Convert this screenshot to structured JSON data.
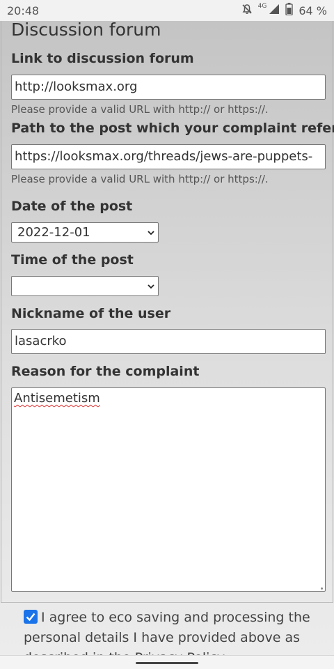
{
  "status_bar": {
    "time": "20:48",
    "network": "4G",
    "battery": "64 %"
  },
  "form": {
    "section_title": "Discussion forum",
    "forum_link": {
      "label": "Link to discussion forum",
      "value": "http://looksmax.org",
      "hint": "Please provide a valid URL with http:// or https://."
    },
    "post_path": {
      "label": "Path to the post which your complaint refers to",
      "value": "https://looksmax.org/threads/jews-are-puppets-",
      "hint": "Please provide a valid URL with http:// or https://."
    },
    "post_date": {
      "label": "Date of the post",
      "value": "2022-12-01"
    },
    "post_time": {
      "label": "Time of the post",
      "value": ""
    },
    "nickname": {
      "label": "Nickname of the user",
      "value": "lasacrko"
    },
    "reason": {
      "label": "Reason for the complaint",
      "value": "Antisemetism"
    },
    "consent": {
      "checked": true,
      "text": "I agree to eco saving and processing the personal details I have provided above as described in the Privacy Policy"
    }
  },
  "colors": {
    "checkbox": "#1a73e8",
    "spellcheck": "#e03030"
  }
}
